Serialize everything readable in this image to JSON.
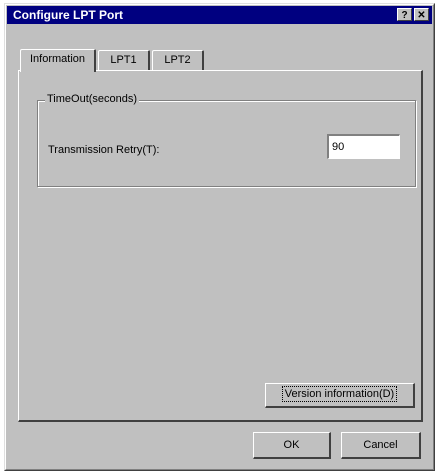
{
  "window": {
    "title": "Configure LPT Port",
    "help_glyph": "?",
    "close_glyph": "✕"
  },
  "tabs": [
    {
      "label": "Information",
      "active": true
    },
    {
      "label": "LPT1",
      "active": false
    },
    {
      "label": "LPT2",
      "active": false
    }
  ],
  "timeout_group": {
    "label": "TimeOut(seconds)",
    "transmission_retry_label": "Transmission Retry(T):",
    "transmission_retry_value": "90"
  },
  "buttons": {
    "version_info": "Version information(D)",
    "ok": "OK",
    "cancel": "Cancel"
  }
}
